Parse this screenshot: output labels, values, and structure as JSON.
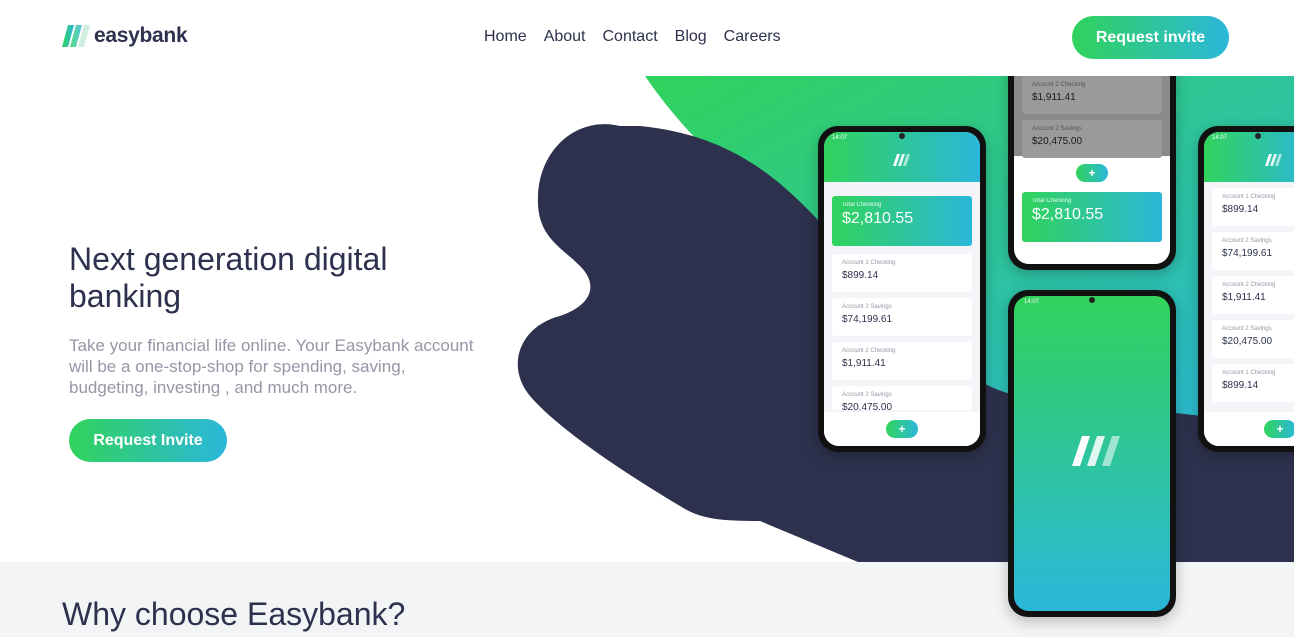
{
  "brand": {
    "name": "easybank",
    "colors": {
      "primary_dark": "#2d314d",
      "green": "#31d35c",
      "cyan": "#2bb7da",
      "gray": "#9597a7"
    }
  },
  "nav": {
    "items": [
      "Home",
      "About",
      "Contact",
      "Blog",
      "Careers"
    ]
  },
  "header": {
    "cta_label": "Request invite"
  },
  "hero": {
    "title": "Next generation digital banking",
    "description": "Take your financial life online. Your Easybank account will be a one-stop-shop for spending, saving, budgeting, investing , and much more.",
    "cta_label": "Request Invite"
  },
  "phones": {
    "left": {
      "time": "14:07",
      "total_label": "Total Checking",
      "total_value": "$2,810.55",
      "accounts": [
        {
          "label": "Account 1 Checking",
          "value": "$899.14"
        },
        {
          "label": "Account 2 Savings",
          "value": "$74,199.61"
        },
        {
          "label": "Account 2 Checking",
          "value": "$1,911.41"
        },
        {
          "label": "Account 2 Savings",
          "value": "$20,475.00"
        }
      ],
      "plus": "+"
    },
    "top": {
      "accounts": [
        {
          "label": "Account 2 Checking",
          "value": "$1,911.41"
        },
        {
          "label": "Account 2 Savings",
          "value": "$20,475.00"
        }
      ],
      "total_label": "Total Checking",
      "total_value": "$2,810.55",
      "plus": "+"
    },
    "right": {
      "time": "14:07",
      "accounts": [
        {
          "label": "Account 1 Checking",
          "value": "$899.14"
        },
        {
          "label": "Account 2 Savings",
          "value": "$74,199.61"
        },
        {
          "label": "Account 2 Checking",
          "value": "$1,911.41"
        },
        {
          "label": "Account 2 Savings",
          "value": "$20,475.00"
        },
        {
          "label": "Account 1 Checking",
          "value": "$899.14"
        }
      ],
      "plus": "+"
    },
    "front": {
      "time": "14:07"
    }
  },
  "why": {
    "title": "Why choose Easybank?"
  }
}
